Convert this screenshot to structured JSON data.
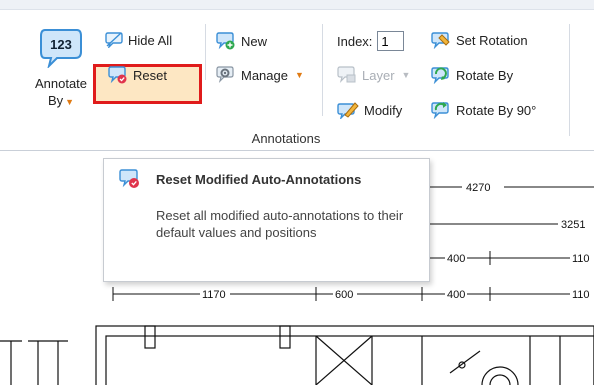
{
  "ribbon": {
    "annotate_by": {
      "label_line1": "Annotate",
      "label_line2": "By",
      "icon_text": "123"
    },
    "hide_all_label": "Hide All",
    "reset_label": "Reset",
    "new_label": "New",
    "manage_label": "Manage",
    "index_label": "Index:",
    "index_value": "1",
    "layer_label": "Layer",
    "modify_label": "Modify",
    "set_rotation_label": "Set Rotation",
    "rotate_by_label": "Rotate By",
    "rotate_by_90_label": "Rotate By 90°",
    "group_label": "Annotations"
  },
  "tooltip": {
    "title": "Reset Modified Auto-Annotations",
    "description": "Reset all modified auto-annotations to their default values and positions"
  },
  "drawing": {
    "dims": [
      "4270",
      "3251",
      "400",
      "110",
      "1170",
      "600",
      "400",
      "110"
    ]
  },
  "colors": {
    "highlight_border": "#e01b1b",
    "highlight_fill": "#fde7c3",
    "dropdown_caret": "#e07b14",
    "icon_blue": "#3b8fd6"
  }
}
